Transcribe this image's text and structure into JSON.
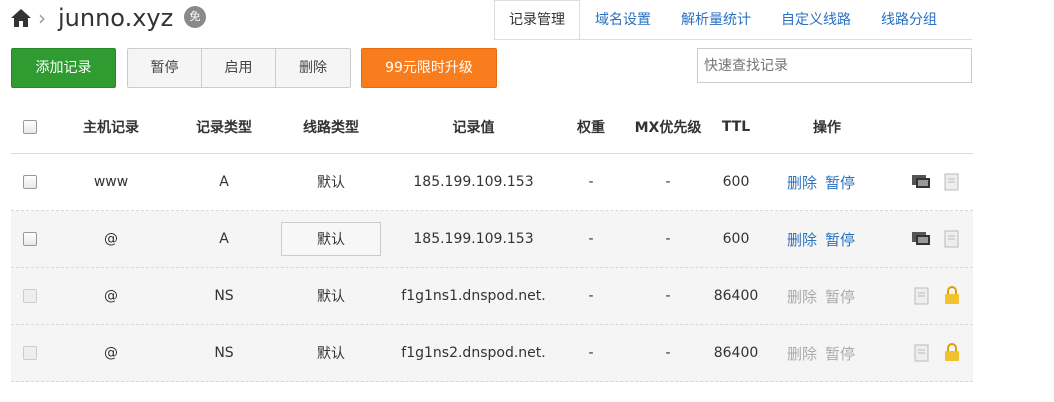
{
  "header": {
    "domain": "junno.xyz",
    "free_badge": "免",
    "tabs": [
      {
        "label": "记录管理",
        "active": true
      },
      {
        "label": "域名设置",
        "active": false
      },
      {
        "label": "解析量统计",
        "active": false
      },
      {
        "label": "自定义线路",
        "active": false
      },
      {
        "label": "线路分组",
        "active": false
      }
    ]
  },
  "toolbar": {
    "add_label": "添加记录",
    "pause_label": "暂停",
    "enable_label": "启用",
    "delete_label": "删除",
    "upgrade_label": "99元限时升级",
    "search_placeholder": "快速查找记录"
  },
  "table": {
    "columns": [
      "主机记录",
      "记录类型",
      "线路类型",
      "记录值",
      "权重",
      "MX优先级",
      "TTL",
      "操作"
    ],
    "rows": [
      {
        "host": "www",
        "type": "A",
        "line": "默认",
        "value": "185.199.109.153",
        "weight": "-",
        "mx": "-",
        "ttl": "600",
        "delete": "删除",
        "pause": "暂停"
      },
      {
        "host": "@",
        "type": "A",
        "line": "默认",
        "value": "185.199.109.153",
        "weight": "-",
        "mx": "-",
        "ttl": "600",
        "delete": "删除",
        "pause": "暂停"
      },
      {
        "host": "@",
        "type": "NS",
        "line": "默认",
        "value": "f1g1ns1.dnspod.net.",
        "weight": "-",
        "mx": "-",
        "ttl": "86400",
        "delete": "删除",
        "pause": "暂停"
      },
      {
        "host": "@",
        "type": "NS",
        "line": "默认",
        "value": "f1g1ns2.dnspod.net.",
        "weight": "-",
        "mx": "-",
        "ttl": "86400",
        "delete": "删除",
        "pause": "暂停"
      }
    ]
  },
  "colors": {
    "add_button": "#2f9b30",
    "upgrade_button": "#f97d1c",
    "link": "#2a71c0",
    "lock": "#f2c12e"
  }
}
